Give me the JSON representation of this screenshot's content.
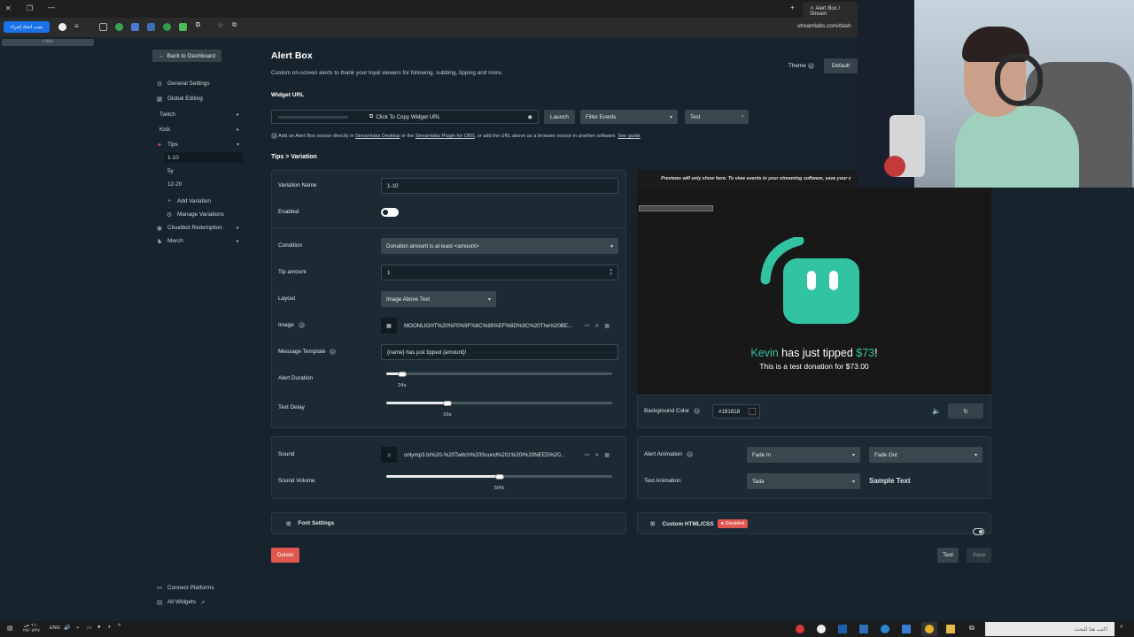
{
  "browser": {
    "tab_title": "Alert Box / Stream",
    "url": "streamlabs.com/dash",
    "ext_badge": "یجب اتخاذ إجراء",
    "bookmark": "3 files"
  },
  "sidebar": {
    "back": "Back to Dashboard",
    "items": [
      {
        "label": "General Settings",
        "icon": "gear-icon"
      },
      {
        "label": "Global Editing",
        "icon": "grid-icon"
      },
      {
        "label": "Twitch"
      },
      {
        "label": "Kick"
      },
      {
        "label": "Tips",
        "icon": "tips-icon"
      },
      {
        "label": "1-10"
      },
      {
        "label": "5y"
      },
      {
        "label": "12-20"
      },
      {
        "label": "Add Variation"
      },
      {
        "label": "Manage Variations"
      },
      {
        "label": "Cloudbot Redemption"
      },
      {
        "label": "Merch"
      }
    ],
    "connect": "Connect Platforms",
    "all_widgets": "All Widgets"
  },
  "header": {
    "title": "Alert Box",
    "subtitle": "Custom on-screen alerts to thank your loyal viewers for following, subbing, tipping and more.",
    "theme_label": "Theme",
    "theme_value": "Default"
  },
  "widget_url": {
    "label": "Widget URL",
    "copy_label": "Click To Copy Widget URL",
    "launch": "Launch",
    "filter": "Filter Events",
    "test": "Test",
    "help_a": "Add an Alert Box source directly in",
    "help_link1": "Streamlabs Desktop",
    "help_b": "or the",
    "help_link2": "Streamlabs Plugin for OBS",
    "help_c": ", or add the URL above as a browser source in another software.",
    "help_link3": "See guide"
  },
  "breadcrumb": "Tips > Variation",
  "form": {
    "variation_name_label": "Variation Name",
    "variation_name": "1-10",
    "enabled_label": "Enabled",
    "condition_label": "Condition",
    "condition": "Donation amount is at least <amount>",
    "tip_amount_label": "Tip amount",
    "tip_amount": "1",
    "layout_label": "Layout",
    "layout": "Image Above Text",
    "image_label": "Image",
    "image_file": "MOONLIGHT%20%F0%9F%8C%95%EF%8D%9C%20The%20BE...",
    "message_label": "Message Template",
    "message": "{name} has just tipped {amount}!",
    "duration_label": "Alert Duration",
    "duration_value": "24s",
    "duration_fraction": 0.07,
    "delay_label": "Text Delay",
    "delay_value": "16s",
    "delay_fraction": 0.27,
    "sound_label": "Sound",
    "sound_file": "onlymp3.to%20-%20Twitch%20Sound%201%20I%20NEED%20...",
    "volume_label": "Sound Volume",
    "volume_value": "50%",
    "volume_fraction": 0.5,
    "font_settings": "Font Settings"
  },
  "preview": {
    "notice": "Previews will only show here. To view events in your streaming software, save your c",
    "name": "Kevin",
    "mid": " has just tipped ",
    "amount": "$73",
    "end": "!",
    "sub": "This is a test donation for $73.00",
    "bg_label": "Background Color",
    "bg_value": "#181818"
  },
  "animation": {
    "alert_label": "Alert Animation",
    "in": "Fade In",
    "out": "Fade Out",
    "text_label": "Text Animation",
    "text": "Tada",
    "sample": "Sample Text"
  },
  "custom": {
    "label": "Custom HTML/CSS",
    "badge": "Disabled"
  },
  "footer": {
    "delete": "Delete",
    "test": "Test",
    "save": "Save"
  },
  "taskbar": {
    "time": "٦:١٠ ص",
    "date": "٢٧/٠٧/٢٧",
    "lang": "ENG",
    "search": "اكتب هنا للبحث"
  },
  "colors": {
    "accent": "#31c3a2",
    "danger": "#e0574f",
    "bg": "#17242d"
  }
}
